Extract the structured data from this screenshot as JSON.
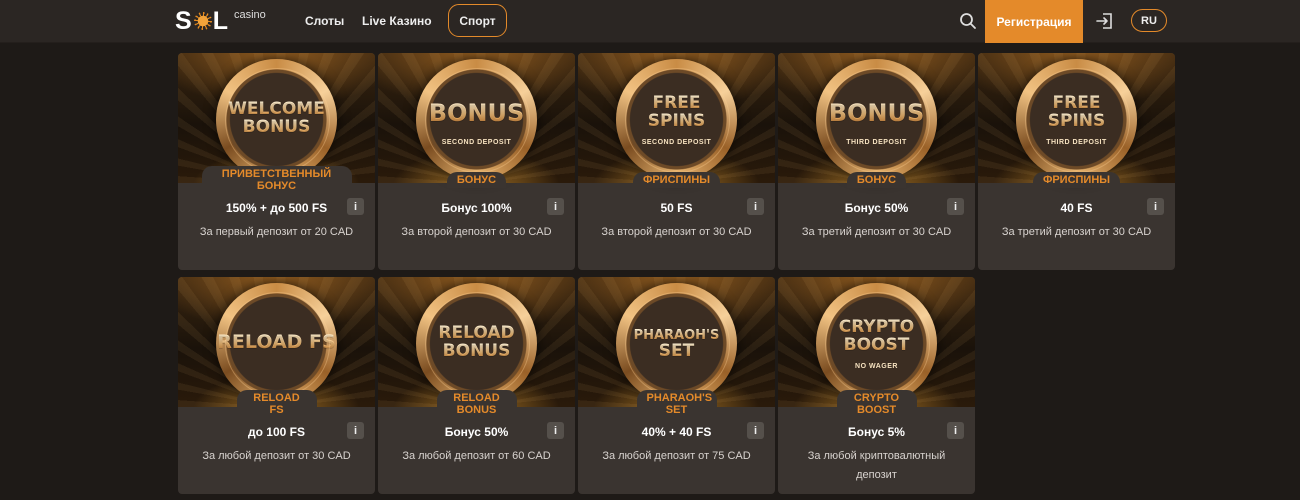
{
  "header": {
    "logo": {
      "word": "SOL",
      "sub": "casino"
    },
    "nav": [
      {
        "label": "Слоты"
      },
      {
        "label": "Live Казино"
      }
    ],
    "sport_label": "Спорт",
    "register_label": "Регистрация",
    "lang_label": "RU"
  },
  "colors": {
    "accent": "#e48a2a",
    "background": "#1e1a17",
    "card": "#3a3430",
    "header": "#2b2623"
  },
  "cards": [
    {
      "badge_lines": [
        "WELCOME",
        "BONUS"
      ],
      "badge_sub": "",
      "ribbon": "ПРИВЕТСТВЕННЫЙ БОНУС",
      "amount": "150% + до 500 FS",
      "condition": "За первый депозит от 20 CAD",
      "info": "i"
    },
    {
      "badge_lines": [
        "BONUS"
      ],
      "badge_sub": "SECOND DEPOSIT",
      "ribbon": "БОНУС",
      "amount": "Бонус 100%",
      "condition": "За второй депозит от 30 CAD",
      "info": "i"
    },
    {
      "badge_lines": [
        "FREE",
        "SPINS"
      ],
      "badge_sub": "SECOND DEPOSIT",
      "ribbon": "ФРИСПИНЫ",
      "amount": "50 FS",
      "condition": "За второй депозит от 30 CAD",
      "info": "i"
    },
    {
      "badge_lines": [
        "BONUS"
      ],
      "badge_sub": "THIRD DEPOSIT",
      "ribbon": "БОНУС",
      "amount": "Бонус 50%",
      "condition": "За третий депозит от 30 CAD",
      "info": "i"
    },
    {
      "badge_lines": [
        "FREE",
        "SPINS"
      ],
      "badge_sub": "THIRD DEPOSIT",
      "ribbon": "ФРИСПИНЫ",
      "amount": "40 FS",
      "condition": "За третий депозит от 30 CAD",
      "info": "i"
    },
    {
      "badge_lines": [
        "RELOAD FS"
      ],
      "badge_sub": "",
      "ribbon": "RELOAD FS",
      "amount": "до 100 FS",
      "condition": "За любой депозит от 30 CAD",
      "info": "i"
    },
    {
      "badge_lines": [
        "RELOAD",
        "BONUS"
      ],
      "badge_sub": "",
      "ribbon": "RELOAD BONUS",
      "amount": "Бонус 50%",
      "condition": "За любой депозит от 60 CAD",
      "info": "i"
    },
    {
      "badge_lines": [
        "PHARAOH'S",
        "SET"
      ],
      "badge_sub": "",
      "ribbon": "PHARAOH'S SET",
      "amount": "40% + 40 FS",
      "condition": "За любой депозит от 75 CAD",
      "info": "i"
    },
    {
      "badge_lines": [
        "CRYPTO",
        "BOOST"
      ],
      "badge_sub": "NO WAGER",
      "ribbon": "CRYPTO BOOST",
      "amount": "Бонус 5%",
      "condition": "За любой криптовалютный депозит",
      "info": "i"
    }
  ]
}
